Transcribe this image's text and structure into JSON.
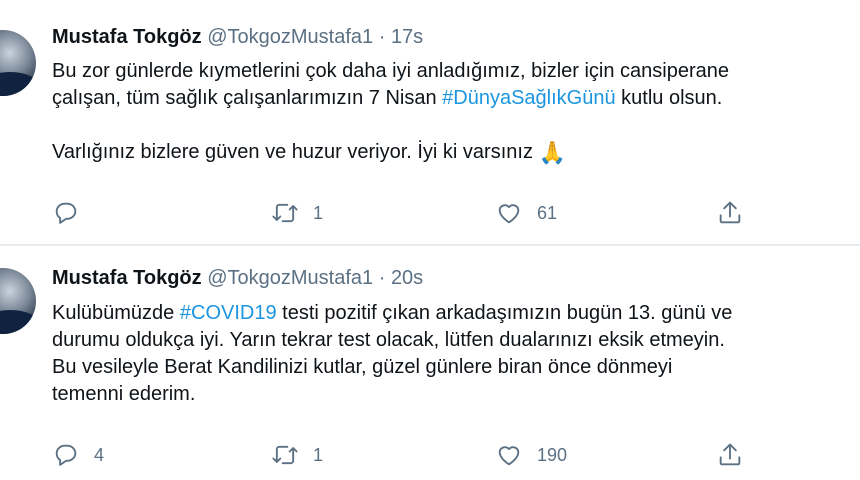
{
  "tweets": [
    {
      "author": "Mustafa Tokgöz",
      "handle": "@TokgozMustafa1",
      "separator": "·",
      "time": "17s",
      "lines": [
        [
          {
            "text": "Bu zor günlerde kıymetlerini çok daha iyi anladığımız, bizler için cansiperane"
          }
        ],
        [
          {
            "text": "çalışan, tüm sağlık çalışanlarımızın 7 Nisan "
          },
          {
            "text": "#DünyaSağlıkGünü",
            "hashtag": true
          },
          {
            "text": " kutlu olsun."
          }
        ],
        [],
        [
          {
            "text": "Varlığınız bizlere güven ve huzur veriyor. İyi ki varsınız "
          },
          {
            "emoji": "🙏"
          }
        ]
      ],
      "replies": "",
      "retweets": "1",
      "likes": "61"
    },
    {
      "author": "Mustafa Tokgöz",
      "handle": "@TokgozMustafa1",
      "separator": "·",
      "time": "20s",
      "lines": [
        [
          {
            "text": "Kulübümüzde "
          },
          {
            "text": "#COVID19",
            "hashtag": true
          },
          {
            "text": " testi pozitif çıkan arkadaşımızın bugün 13. günü ve"
          }
        ],
        [
          {
            "text": "durumu oldukça iyi. Yarın tekrar test olacak, lütfen dualarınızı eksik etmeyin."
          }
        ],
        [
          {
            "text": "Bu vesileyle Berat Kandilinizi kutlar, güzel günlere biran önce dönmeyi"
          }
        ],
        [
          {
            "text": "temenni ederim."
          }
        ]
      ],
      "replies": "4",
      "retweets": "1",
      "likes": "190"
    }
  ],
  "icons": {
    "reply": "reply-icon",
    "retweet": "retweet-icon",
    "like": "heart-icon",
    "share": "share-icon"
  },
  "colors": {
    "hashtag": "#1b95e0",
    "secondary_text": "#5b7083",
    "divider": "#e6ecf0"
  }
}
